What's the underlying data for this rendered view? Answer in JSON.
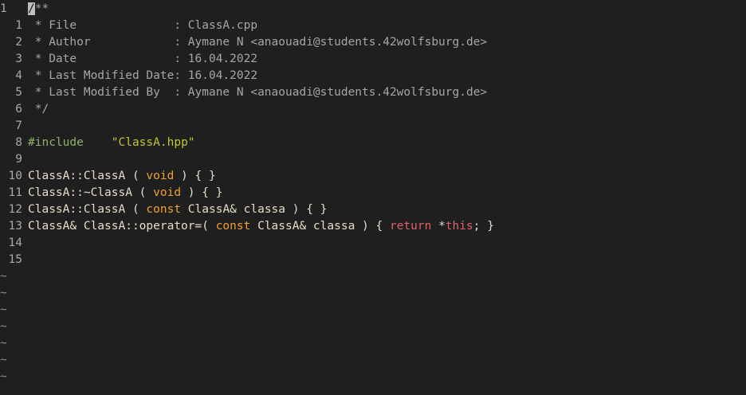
{
  "editor": {
    "lines": [
      {
        "num": "1",
        "segments": [
          {
            "t": "/",
            "c": "cursor"
          },
          {
            "t": "**",
            "c": "c-comment"
          }
        ]
      },
      {
        "num": "1",
        "segments": [
          {
            "t": " * File              : ClassA.cpp",
            "c": "c-comment"
          }
        ]
      },
      {
        "num": "2",
        "segments": [
          {
            "t": " * Author            : Aymane N <anaouadi@students.42wolfsburg.de>",
            "c": "c-comment"
          }
        ]
      },
      {
        "num": "3",
        "segments": [
          {
            "t": " * Date              : 16.04.2022",
            "c": "c-comment"
          }
        ]
      },
      {
        "num": "4",
        "segments": [
          {
            "t": " * Last Modified Date: 16.04.2022",
            "c": "c-comment"
          }
        ]
      },
      {
        "num": "5",
        "segments": [
          {
            "t": " * Last Modified By  : Aymane N <anaouadi@students.42wolfsburg.de>",
            "c": "c-comment"
          }
        ]
      },
      {
        "num": "6",
        "segments": [
          {
            "t": " */",
            "c": "c-comment"
          }
        ]
      },
      {
        "num": "7",
        "segments": []
      },
      {
        "num": "8",
        "segments": [
          {
            "t": "#include",
            "c": "c-pre"
          },
          {
            "t": "    ",
            "c": "c-plain"
          },
          {
            "t": "\"ClassA.hpp\"",
            "c": "c-str"
          }
        ]
      },
      {
        "num": "9",
        "segments": []
      },
      {
        "num": "10",
        "segments": [
          {
            "t": "ClassA::ClassA ( ",
            "c": "c-plain"
          },
          {
            "t": "void",
            "c": "c-kw"
          },
          {
            "t": " ) { }",
            "c": "c-plain"
          }
        ]
      },
      {
        "num": "11",
        "segments": [
          {
            "t": "ClassA::~ClassA ( ",
            "c": "c-plain"
          },
          {
            "t": "void",
            "c": "c-kw"
          },
          {
            "t": " ) { }",
            "c": "c-plain"
          }
        ]
      },
      {
        "num": "12",
        "segments": [
          {
            "t": "ClassA::ClassA ( ",
            "c": "c-plain"
          },
          {
            "t": "const",
            "c": "c-kw"
          },
          {
            "t": " ClassA& classa ) { }",
            "c": "c-plain"
          }
        ]
      },
      {
        "num": "13",
        "segments": [
          {
            "t": "ClassA& ClassA::operator=( ",
            "c": "c-plain"
          },
          {
            "t": "const",
            "c": "c-kw"
          },
          {
            "t": " ClassA& classa ) { ",
            "c": "c-plain"
          },
          {
            "t": "return",
            "c": "c-ret"
          },
          {
            "t": " *",
            "c": "c-plain"
          },
          {
            "t": "this",
            "c": "c-ret"
          },
          {
            "t": "; }",
            "c": "c-plain"
          }
        ]
      },
      {
        "num": "14",
        "segments": []
      },
      {
        "num": "15",
        "segments": []
      }
    ],
    "tilde": "~",
    "tilde_count": 7
  }
}
